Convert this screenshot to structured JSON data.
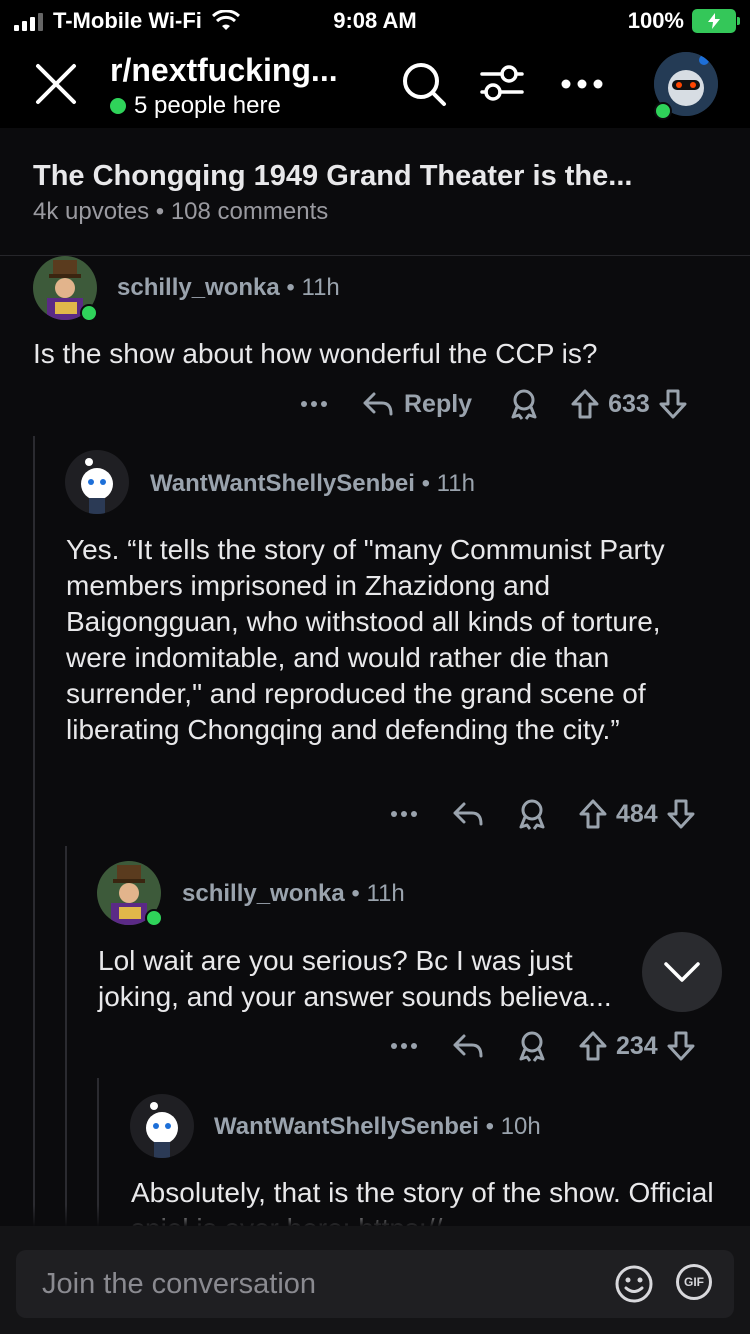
{
  "status": {
    "carrier": "T-Mobile Wi-Fi",
    "time": "9:08 AM",
    "battery": "100%"
  },
  "header": {
    "subreddit": "r/nextfucking...",
    "people_here": "5 people here"
  },
  "post": {
    "title": "The Chongqing 1949 Grand Theater is the...",
    "upvotes": "4k upvotes",
    "separator": "•",
    "comments": "108 comments"
  },
  "comments": [
    {
      "user": "schilly_wonka",
      "time": "11h",
      "body": "Is the show about how wonderful the CCP is?",
      "reply_label": "Reply",
      "score": "633"
    },
    {
      "user": "WantWantShellySenbei",
      "time": "11h",
      "body": "Yes. “It tells the story of \"many Communist Party members imprisoned in Zhazidong and Baigongguan, who withstood all kinds of torture, were indomitable, and would rather die than surrender,\" and reproduced the grand scene of liberating Chongqing and defending the city.”",
      "score": "484"
    },
    {
      "user": "schilly_wonka",
      "time": "11h",
      "body": "Lol wait are you serious? Bc I was just joking, and your answer sounds believa...",
      "score": "234"
    },
    {
      "user": "WantWantShellySenbei",
      "time": "10h",
      "body": "Absolutely, that is the story of the show. Official spiel is over here: https://"
    }
  ],
  "composer": {
    "placeholder": "Join the conversation",
    "gif_label": "GIF"
  },
  "colors": {
    "accent_green": "#2fd35a",
    "background": "#0b0b0d",
    "meta": "#9aa3ad",
    "link": "#4aa3ff"
  }
}
